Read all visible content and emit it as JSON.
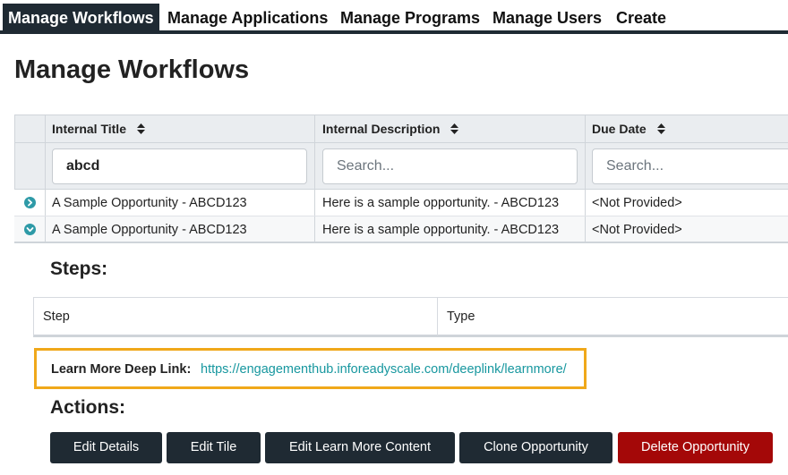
{
  "nav": {
    "items": [
      {
        "label": "Manage Workflows",
        "active": true
      },
      {
        "label": "Manage Applications"
      },
      {
        "label": "Manage Programs"
      },
      {
        "label": "Manage Users"
      },
      {
        "label": "Create"
      }
    ]
  },
  "page": {
    "title": "Manage Workflows"
  },
  "table": {
    "columns": [
      "Internal Title",
      "Internal Description",
      "Due Date"
    ],
    "filters": [
      {
        "value": "abcd",
        "placeholder": "Search..."
      },
      {
        "value": "",
        "placeholder": "Search..."
      },
      {
        "value": "",
        "placeholder": "Search..."
      }
    ],
    "rows": [
      {
        "title": "A Sample Opportunity - ABCD123",
        "description": "Here is a sample opportunity. - ABCD123",
        "due": "<Not Provided>",
        "expanded": false
      },
      {
        "title": "A Sample Opportunity - ABCD123",
        "description": "Here is a sample opportunity. - ABCD123",
        "due": "<Not Provided>",
        "expanded": true
      }
    ]
  },
  "steps": {
    "title": "Steps:",
    "columns": [
      "Step",
      "Type"
    ]
  },
  "deeplink": {
    "label": "Learn More Deep Link:",
    "url": "https://engagementhub.inforeadyscale.com/deeplink/learnmore/"
  },
  "actions": {
    "title": "Actions:",
    "buttons": [
      "Edit Details",
      "Edit Tile",
      "Edit Learn More Content",
      "Clone Opportunity",
      "Delete Opportunity"
    ]
  },
  "colors": {
    "nav_dark": "#1f2a33",
    "accent_teal": "#2e9aa7",
    "link": "#17979f",
    "highlight": "#f0a81a",
    "danger": "#a40808"
  }
}
